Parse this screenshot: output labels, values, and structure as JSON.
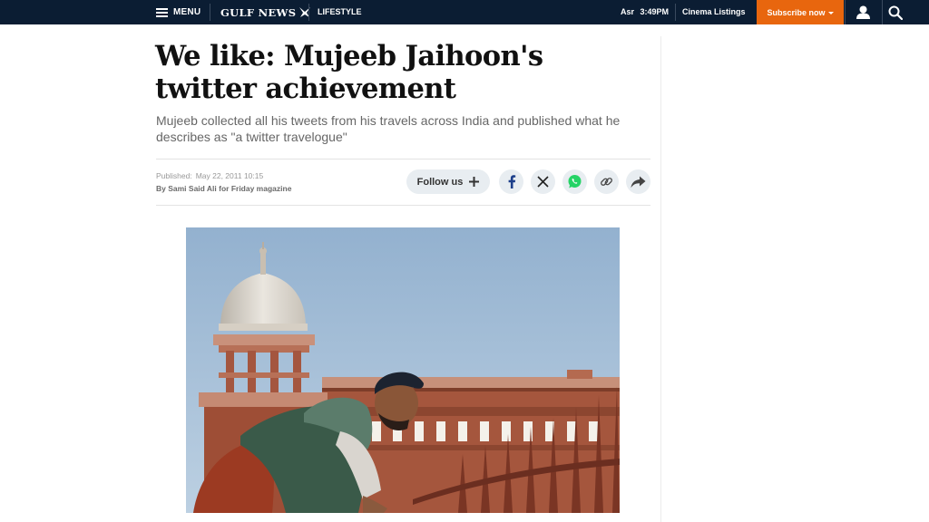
{
  "topbar": {
    "menu_label": "MENU",
    "logo_text": "GULF NEWS",
    "section_label": "LIFESTYLE",
    "prayer_name": "Asr",
    "prayer_time": "3:49PM",
    "cinema_label": "Cinema Listings",
    "subscribe_label": "Subscribe now",
    "icons": [
      "menu-icon",
      "falcon-icon",
      "caret-down-icon",
      "user-icon",
      "search-icon"
    ]
  },
  "article": {
    "headline": "We like: Mujeeb Jaihoon's twitter achievement",
    "summary": "Mujeeb collected all his tweets from his travels across India and published what he describes as \"a twitter travelogue\"",
    "published_label": "Published:",
    "published_date": "May 22, 2011 10:15",
    "byline": "By Sami Said Ali for Friday magazine"
  },
  "social": {
    "follow_label": "Follow us",
    "icons": [
      "plus-icon",
      "facebook-icon",
      "x-icon",
      "whatsapp-icon",
      "link-icon",
      "share-icon"
    ]
  },
  "colors": {
    "topbar_bg": "#0b1d33",
    "subscribe_bg": "#e8660e",
    "whatsapp_green": "#25d366",
    "facebook_blue": "#1d3f8a"
  }
}
